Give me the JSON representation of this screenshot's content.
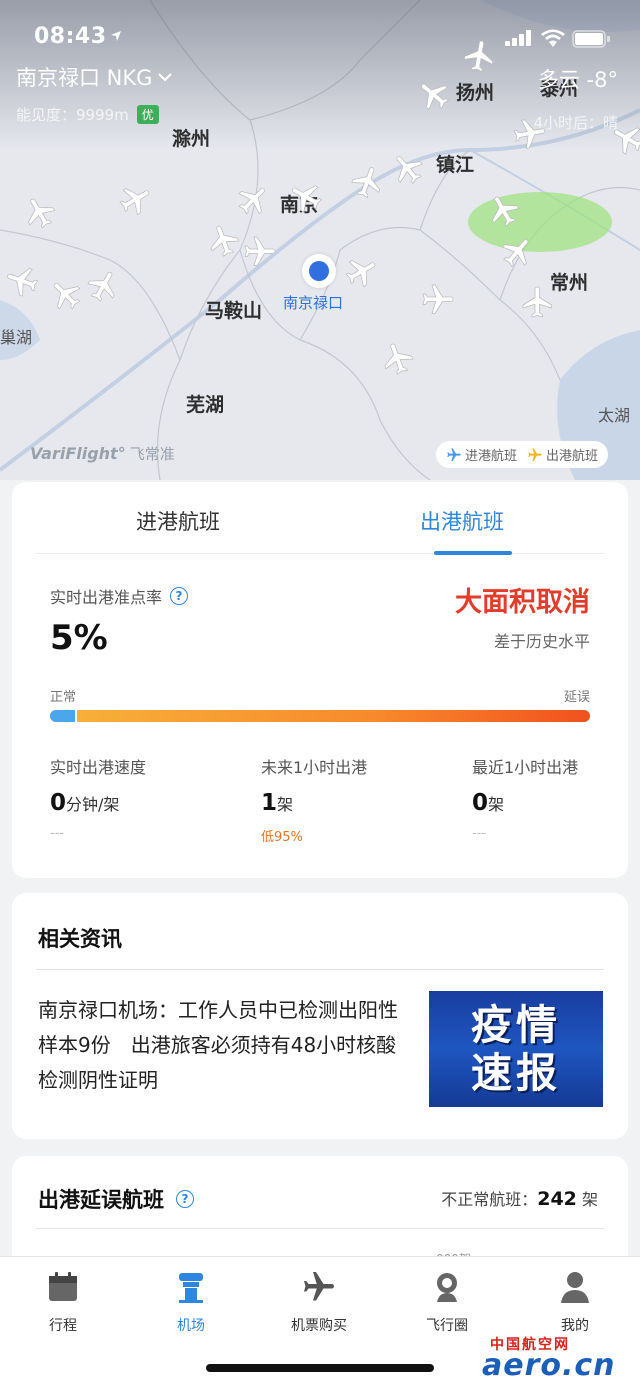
{
  "status_bar": {
    "time": "08:43"
  },
  "header": {
    "airport": "南京禄口 NKG",
    "visibility": "能见度：9999m",
    "aqi": "优",
    "weather": "多云 -8°",
    "forecast": "4小时后：晴"
  },
  "map": {
    "cities": [
      "扬州",
      "泰州",
      "滁州",
      "镇江",
      "南京",
      "常州",
      "马鞍山",
      "芜湖",
      "太湖",
      "巢湖"
    ],
    "airport_marker": "南京禄口",
    "credit": "VariFlight°",
    "credit_cn": "飞常准",
    "legend": {
      "arrivals": "进港航班",
      "departures": "出港航班"
    }
  },
  "flight_tabs": {
    "arrivals": "进港航班",
    "departures": "出港航班",
    "active": "departures"
  },
  "status": {
    "otp_label": "实时出港准点率",
    "otp_value": "5%",
    "cancel_status": "大面积取消",
    "compare": "差于历史水平",
    "scale_normal": "正常",
    "scale_delay": "延误",
    "bar_fraction": 0.05
  },
  "stats": [
    {
      "label": "实时出港速度",
      "value": "0",
      "unit": "分钟/架",
      "sub": "---"
    },
    {
      "label": "未来1小时出港",
      "value": "1",
      "unit": "架",
      "sub": "低95%"
    },
    {
      "label": "最近1小时出港",
      "value": "0",
      "unit": "架",
      "sub": "---"
    }
  ],
  "news": {
    "title": "相关资讯",
    "text": "南京禄口机场：工作人员中已检测出阳性样本9份　出港旅客必须持有48小时核酸检测阴性证明",
    "thumb_line1": "疫情",
    "thumb_line2": "速报"
  },
  "delayed": {
    "title": "出港延误航班",
    "abnormal_label": "不正常航班：",
    "abnormal_count": "242",
    "abnormal_unit": "架",
    "peek": "000架"
  },
  "nav": [
    "行程",
    "机场",
    "机票购买",
    "飞行圈",
    "我的"
  ],
  "watermark": {
    "cn": "中国航空网",
    "en": "aero.cn"
  },
  "colors": {
    "accent": "#2f86de",
    "alert": "#e23c2a",
    "warn": "#e67422"
  }
}
